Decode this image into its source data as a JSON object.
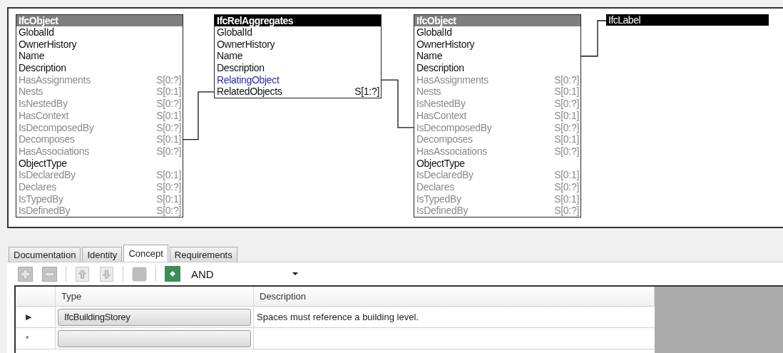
{
  "diagram": {
    "nodes": [
      {
        "kind": "entity",
        "selected": false,
        "title": "IfcObject",
        "attributes": [
          {
            "name": "GlobalId",
            "kind": "direct"
          },
          {
            "name": "OwnerHistory",
            "kind": "direct"
          },
          {
            "name": "Name",
            "kind": "direct"
          },
          {
            "name": "Description",
            "kind": "direct"
          },
          {
            "name": "HasAssignments",
            "kind": "inverse",
            "cardinality": "S[0:?]"
          },
          {
            "name": "Nests",
            "kind": "inverse",
            "cardinality": "S[0:1]"
          },
          {
            "name": "IsNestedBy",
            "kind": "inverse",
            "cardinality": "S[0:?]"
          },
          {
            "name": "HasContext",
            "kind": "inverse",
            "cardinality": "S[0:1]"
          },
          {
            "name": "IsDecomposedBy",
            "kind": "inverse",
            "cardinality": "S[0:?]"
          },
          {
            "name": "Decomposes",
            "kind": "inverse",
            "cardinality": "S[0:1]"
          },
          {
            "name": "HasAssociations",
            "kind": "inverse",
            "cardinality": "S[0:?]"
          },
          {
            "name": "ObjectType",
            "kind": "direct"
          },
          {
            "name": "IsDeclaredBy",
            "kind": "inverse",
            "cardinality": "S[0:1]"
          },
          {
            "name": "Declares",
            "kind": "inverse",
            "cardinality": "S[0:?]"
          },
          {
            "name": "IsTypedBy",
            "kind": "inverse",
            "cardinality": "S[0:1]"
          },
          {
            "name": "IsDefinedBy",
            "kind": "inverse",
            "cardinality": "S[0:?]"
          }
        ]
      },
      {
        "kind": "entity",
        "selected": true,
        "title": "IfcRelAggregates",
        "attributes": [
          {
            "name": "GlobalId",
            "kind": "direct"
          },
          {
            "name": "OwnerHistory",
            "kind": "direct"
          },
          {
            "name": "Name",
            "kind": "direct"
          },
          {
            "name": "Description",
            "kind": "direct"
          },
          {
            "name": "RelatingObject",
            "kind": "highlighted"
          },
          {
            "name": "RelatedObjects",
            "kind": "direct",
            "cardinality": "S[1:?]"
          }
        ]
      },
      {
        "kind": "entity",
        "selected": false,
        "title": "IfcObject",
        "attributes": [
          {
            "name": "GlobalId",
            "kind": "direct"
          },
          {
            "name": "OwnerHistory",
            "kind": "direct"
          },
          {
            "name": "Name",
            "kind": "direct"
          },
          {
            "name": "Description",
            "kind": "direct"
          },
          {
            "name": "HasAssignments",
            "kind": "inverse",
            "cardinality": "S[0:?]"
          },
          {
            "name": "Nests",
            "kind": "inverse",
            "cardinality": "S[0:1]"
          },
          {
            "name": "IsNestedBy",
            "kind": "inverse",
            "cardinality": "S[0:?]"
          },
          {
            "name": "HasContext",
            "kind": "inverse",
            "cardinality": "S[0:1]"
          },
          {
            "name": "IsDecomposedBy",
            "kind": "inverse",
            "cardinality": "S[0:?]"
          },
          {
            "name": "Decomposes",
            "kind": "inverse",
            "cardinality": "S[0:1]"
          },
          {
            "name": "HasAssociations",
            "kind": "inverse",
            "cardinality": "S[0:?]"
          },
          {
            "name": "ObjectType",
            "kind": "direct"
          },
          {
            "name": "IsDeclaredBy",
            "kind": "inverse",
            "cardinality": "S[0:1]"
          },
          {
            "name": "Declares",
            "kind": "inverse",
            "cardinality": "S[0:?]"
          },
          {
            "name": "IsTypedBy",
            "kind": "inverse",
            "cardinality": "S[0:1]"
          },
          {
            "name": "IsDefinedBy",
            "kind": "inverse",
            "cardinality": "S[0:?]"
          }
        ]
      },
      {
        "kind": "type",
        "title": "IfcLabel"
      }
    ]
  },
  "tabs": [
    {
      "label": "Documentation",
      "selected": false
    },
    {
      "label": "Identity",
      "selected": false
    },
    {
      "label": "Concept",
      "selected": true
    },
    {
      "label": "Requirements",
      "selected": false
    }
  ],
  "toolbar": {
    "buttons": [
      {
        "kind": "add",
        "disabled": true
      },
      {
        "kind": "remove",
        "disabled": true
      },
      {
        "kind": "separator"
      },
      {
        "kind": "up",
        "disabled": true
      },
      {
        "kind": "down",
        "disabled": true
      },
      {
        "kind": "separator"
      },
      {
        "kind": "square",
        "disabled": true
      },
      {
        "kind": "separator"
      },
      {
        "kind": "diamond",
        "disabled": false
      }
    ],
    "operator": {
      "value": "AND"
    }
  },
  "grid": {
    "columns": [
      "Type",
      "Description"
    ],
    "rows": [
      {
        "indicator": "▶",
        "type": "IfcBuildingStorey",
        "description": "Spaces must reference a building level."
      },
      {
        "indicator": "*"
      }
    ]
  }
}
